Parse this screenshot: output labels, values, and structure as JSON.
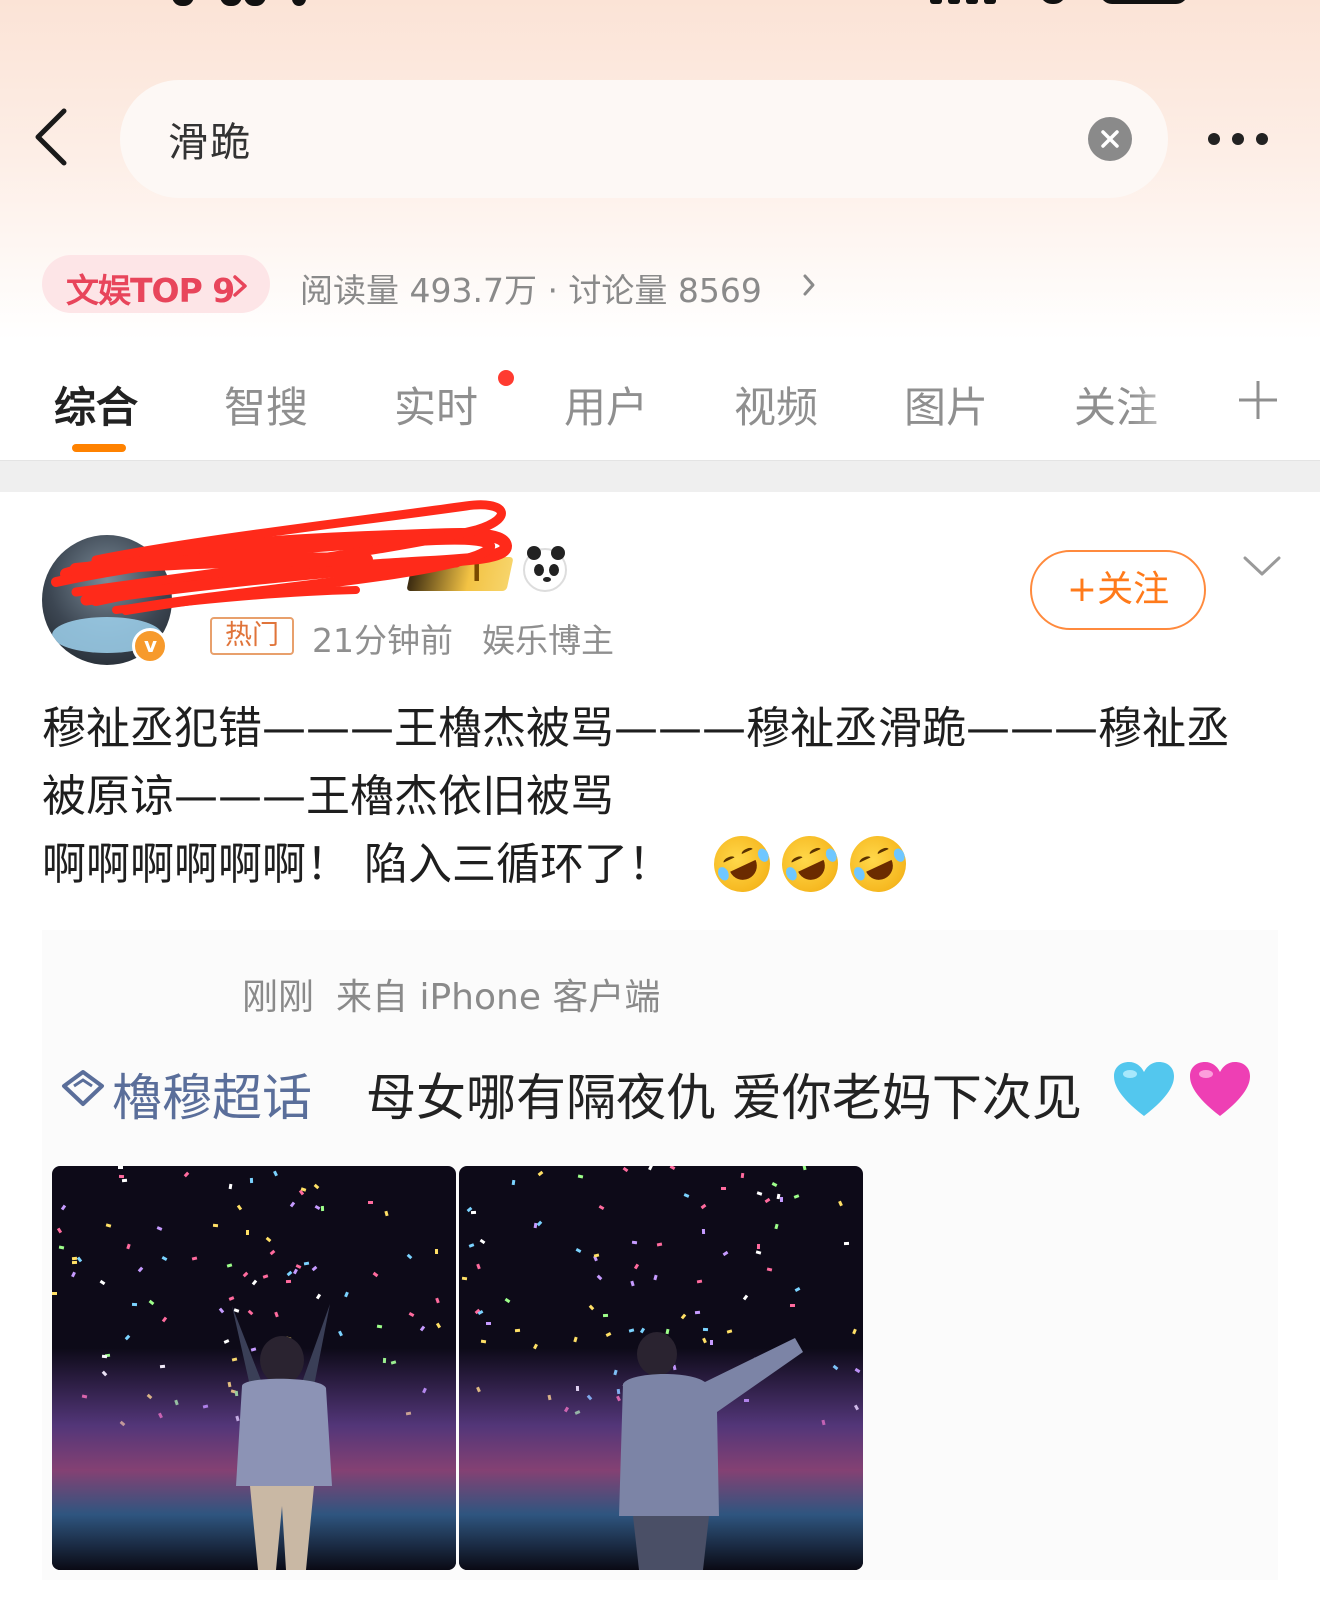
{
  "search": {
    "query": "滑跪"
  },
  "topic_bar": {
    "badge": "文娱TOP 9",
    "stats": "阅读量 493.7万 · 讨论量 8569"
  },
  "tabs": [
    {
      "label": "综合",
      "active": true
    },
    {
      "label": "智搜",
      "active": false
    },
    {
      "label": "实时",
      "active": false,
      "dot": true
    },
    {
      "label": "用户",
      "active": false
    },
    {
      "label": "视频",
      "active": false
    },
    {
      "label": "图片",
      "active": false
    },
    {
      "label": "关注",
      "active": false
    }
  ],
  "post": {
    "vip_level": "I",
    "hot_badge": "热门",
    "time": "21分钟前",
    "category": "娱乐博主",
    "follow_label": "+关注",
    "text_lines": [
      "穆祉丞犯错———王櫓杰被骂———穆祉丞滑跪———穆祉丞",
      "被原谅———王櫓杰依旧被骂",
      "啊啊啊啊啊啊！ 陷入三循环了！"
    ],
    "emoji": "rofl-emoji"
  },
  "quoted": {
    "time": "刚刚",
    "source": "来自 iPhone 客户端",
    "topic": "櫓穆超话",
    "text": "母女哪有隔夜仇 爱你老妈下次见"
  },
  "colors": {
    "accent": "#ff8200",
    "badge_red": "#e8455b",
    "topic_blue": "#5a6e9a",
    "follow_orange": "#ff7a1a"
  }
}
